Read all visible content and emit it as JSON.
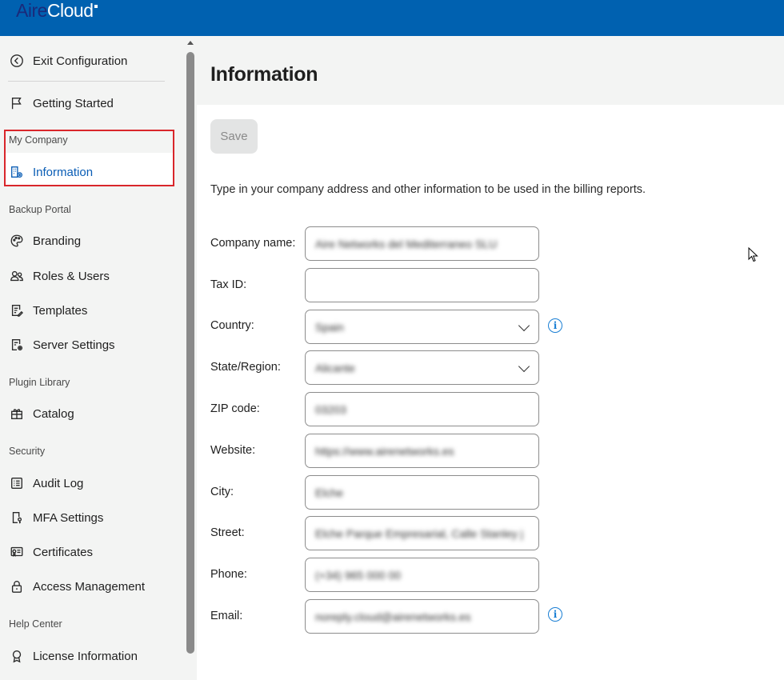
{
  "app": {
    "logo_a": "Aire",
    "logo_b": "Cloud"
  },
  "sidebar": {
    "exit": "Exit Configuration",
    "getting_started": "Getting Started",
    "sections": {
      "my_company": "My Company",
      "backup_portal": "Backup Portal",
      "plugin_library": "Plugin Library",
      "security": "Security",
      "help_center": "Help Center"
    },
    "items": {
      "information": "Information",
      "branding": "Branding",
      "roles_users": "Roles & Users",
      "templates": "Templates",
      "server_settings": "Server Settings",
      "catalog": "Catalog",
      "audit_log": "Audit Log",
      "mfa_settings": "MFA Settings",
      "certificates": "Certificates",
      "access_management": "Access Management",
      "license_information": "License Information"
    },
    "active_item": "information"
  },
  "main": {
    "title": "Information",
    "save_label": "Save",
    "intro": "Type in your company address and other information to be used in the billing reports.",
    "fields": {
      "company_name": {
        "label": "Company name:",
        "value": "Aire Networks del Mediterraneo SLU"
      },
      "tax_id": {
        "label": "Tax ID:",
        "value": ""
      },
      "country": {
        "label": "Country:",
        "value": "Spain"
      },
      "state": {
        "label": "State/Region:",
        "value": "Alicante"
      },
      "zip": {
        "label": "ZIP code:",
        "value": "03203"
      },
      "website": {
        "label": "Website:",
        "value": "https://www.airenetworks.es"
      },
      "city": {
        "label": "City:",
        "value": "Elche"
      },
      "street": {
        "label": "Street:",
        "value": "Elche Parque Empresarial, Calle Stanley j"
      },
      "phone": {
        "label": "Phone:",
        "value": "(+34) 965 000 00"
      },
      "email": {
        "label": "Email:",
        "value": "noreply.cloud@airenetworks.es"
      }
    },
    "info_glyph": "i"
  },
  "colors": {
    "header": "#0061b0",
    "accent": "#0a5db5",
    "highlight_box": "#d9262b"
  }
}
